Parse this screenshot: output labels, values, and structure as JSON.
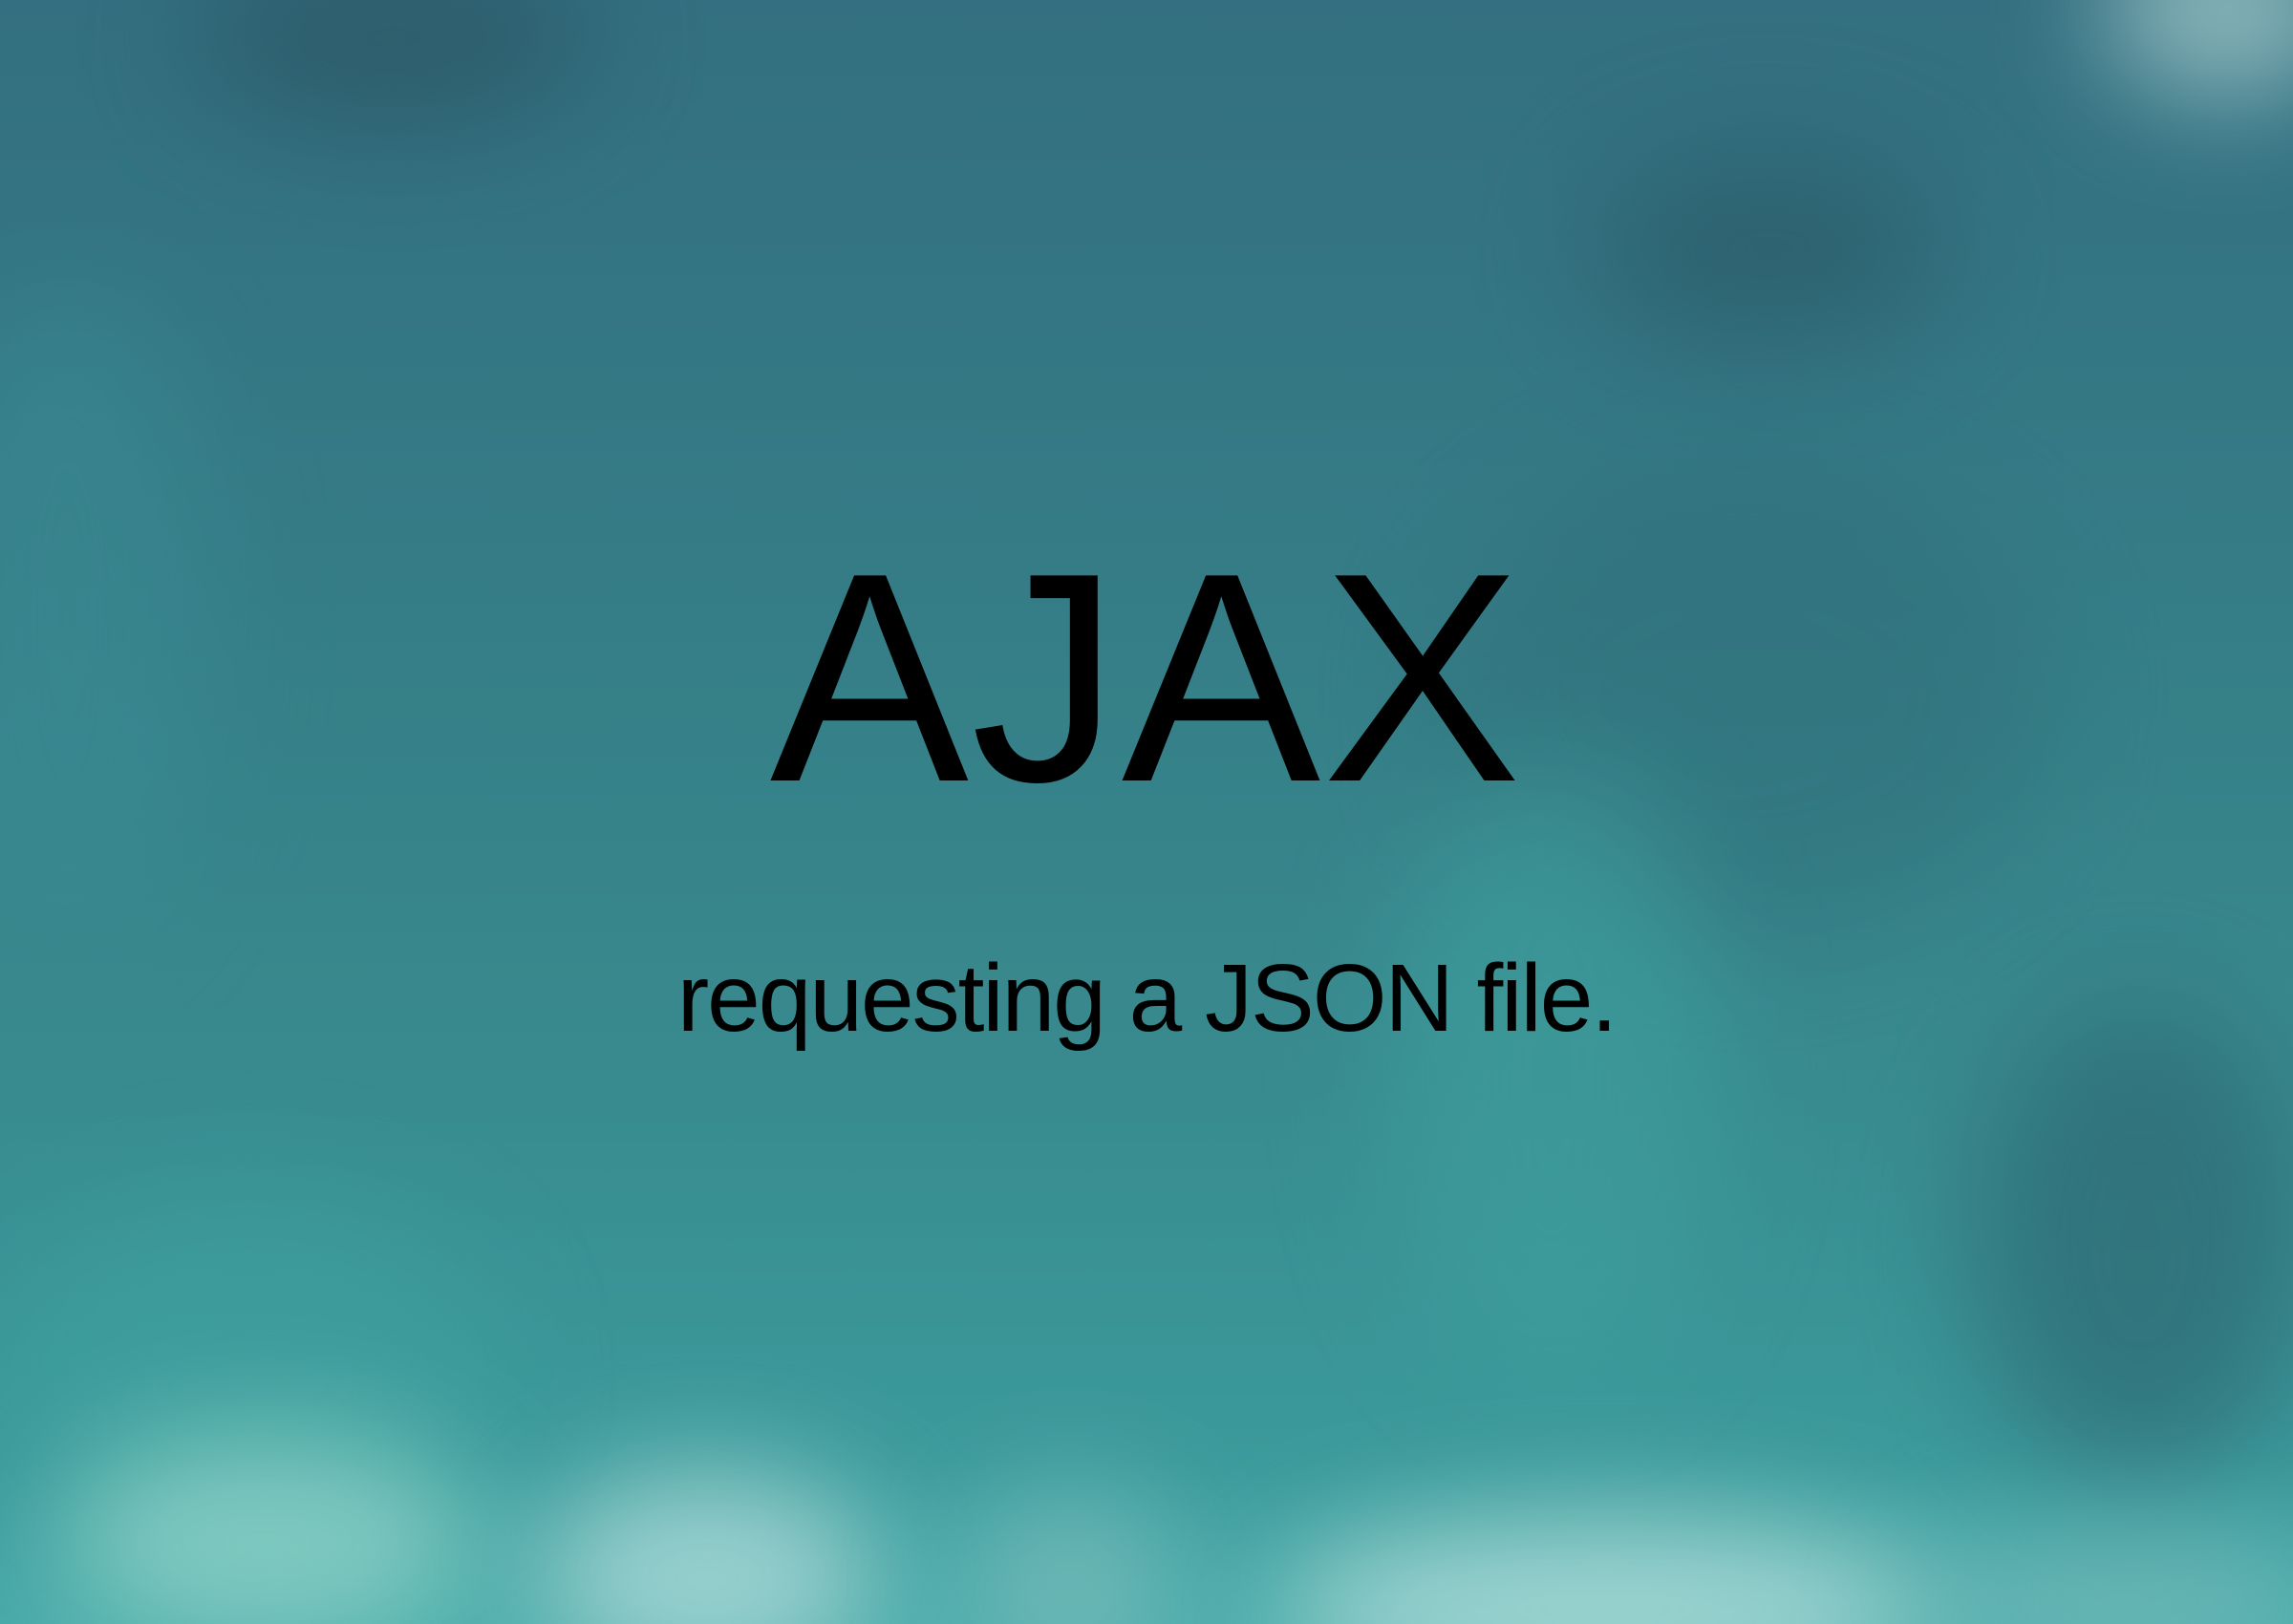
{
  "slide": {
    "title": "AJAX",
    "subtitle": "requesting a JSON file."
  },
  "colors": {
    "background": "#347580",
    "text": "#000000"
  }
}
